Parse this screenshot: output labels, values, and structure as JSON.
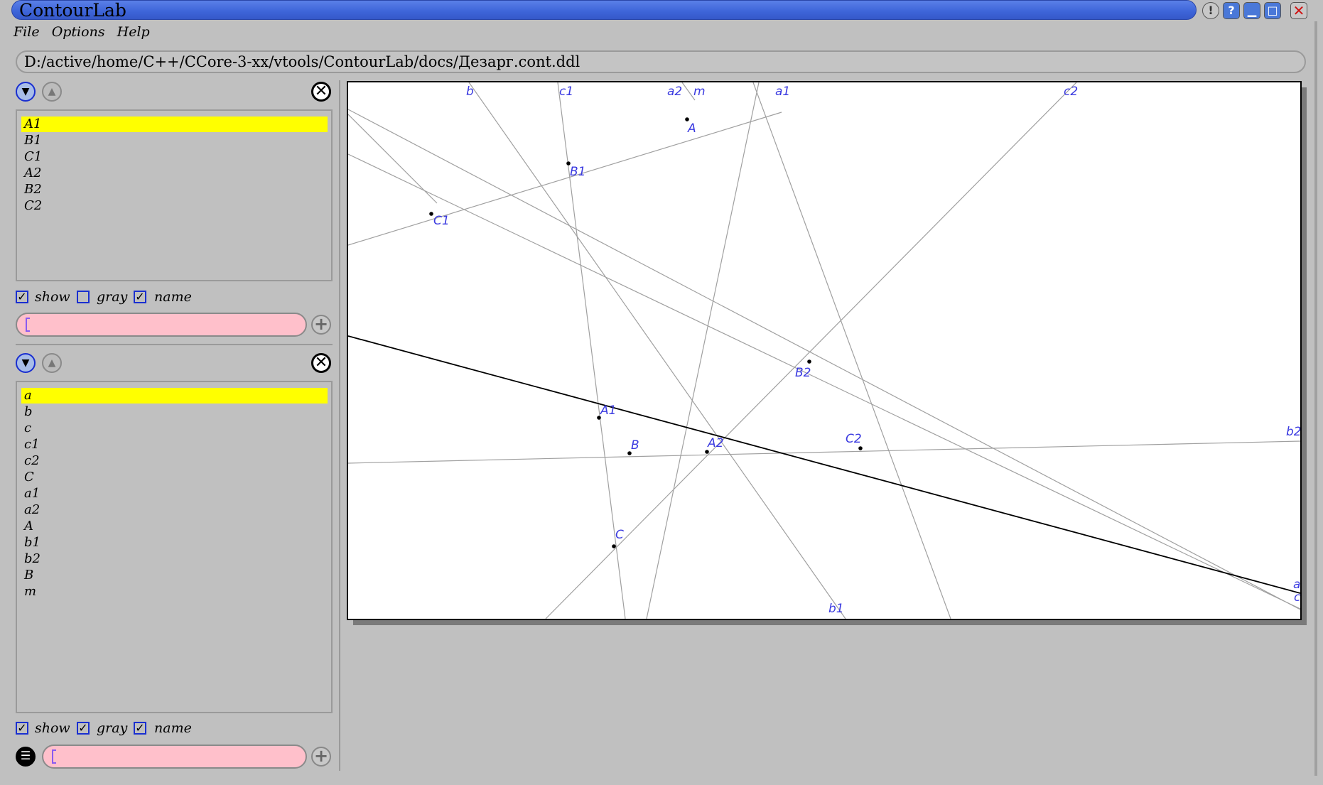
{
  "window": {
    "title": "ContourLab",
    "buttons": [
      "!",
      "?",
      "minimize",
      "maximize",
      "close"
    ]
  },
  "menu": {
    "items": [
      "File",
      "Options",
      "Help"
    ]
  },
  "path": "D:/active/home/C++/CCore-3-xx/vtools/ContourLab/docs/Дезарг.cont.ddl",
  "points_panel": {
    "items": [
      "A1",
      "B1",
      "C1",
      "A2",
      "B2",
      "C2"
    ],
    "selected_index": 0,
    "checks": [
      {
        "label": "show",
        "checked": true
      },
      {
        "label": "gray",
        "checked": false
      },
      {
        "label": "name",
        "checked": true
      }
    ],
    "input_value": ""
  },
  "lines_panel": {
    "items": [
      "a",
      "b",
      "c",
      "c1",
      "c2",
      "C",
      "a1",
      "a2",
      "A",
      "b1",
      "b2",
      "B",
      "m"
    ],
    "selected_index": 0,
    "checks": [
      {
        "label": "show",
        "checked": true
      },
      {
        "label": "gray",
        "checked": true
      },
      {
        "label": "name",
        "checked": true
      }
    ],
    "input_value": ""
  },
  "drawing": {
    "label_color": "#3a3ae0",
    "line_color": "#a0a0a0",
    "point_labels": [
      "A1",
      "B1",
      "C1",
      "A2",
      "B2",
      "C2",
      "A",
      "B",
      "C"
    ],
    "line_labels": [
      "b",
      "c1",
      "a2",
      "m",
      "a1",
      "c2",
      "b2",
      "a",
      "c",
      "b1"
    ]
  }
}
